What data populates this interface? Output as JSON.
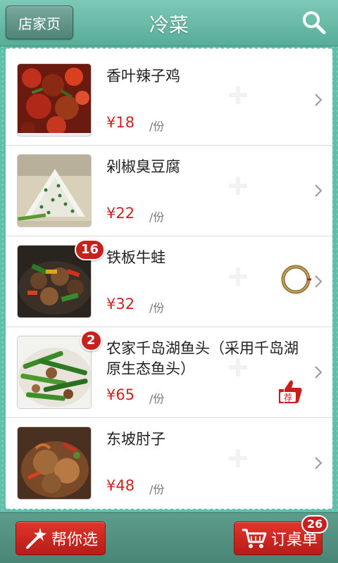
{
  "header": {
    "back_label": "店家页",
    "title": "冷菜",
    "search_icon": "search-icon"
  },
  "dishes": [
    {
      "name": "香叶辣子鸡",
      "price": "¥18",
      "unit": "/份",
      "badge": ""
    },
    {
      "name": "剁椒臭豆腐",
      "price": "¥22",
      "unit": "/份",
      "badge": ""
    },
    {
      "name": "铁板牛蛙",
      "price": "¥32",
      "unit": "/份",
      "badge": "16"
    },
    {
      "name": "农家千岛湖鱼头（采用千岛湖原生态鱼头）",
      "price": "¥65",
      "unit": "/份",
      "badge": "2",
      "recommend_label": "荐"
    },
    {
      "name": "东坡肘子",
      "price": "¥48",
      "unit": "/份",
      "badge": ""
    }
  ],
  "footer": {
    "help_label": "帮你选",
    "order_label": "订桌单",
    "order_count": "26"
  },
  "colors": {
    "accent_red": "#d02222",
    "header_teal": "#6cbba7"
  }
}
